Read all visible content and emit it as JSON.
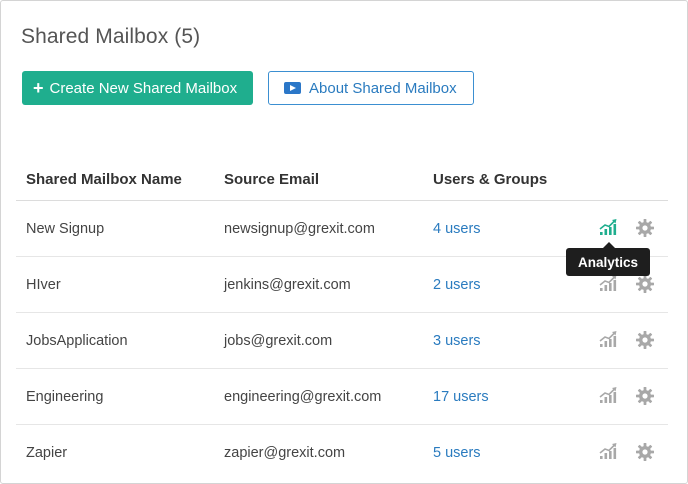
{
  "header": {
    "title": "Shared Mailbox (5)"
  },
  "buttons": {
    "create_label": "Create New Shared Mailbox",
    "create_icon": "plus-icon",
    "about_label": "About Shared Mailbox",
    "about_icon": "video-play-icon"
  },
  "table": {
    "columns": [
      "Shared Mailbox Name",
      "Source Email",
      "Users & Groups"
    ],
    "rows": [
      {
        "name": "New Signup",
        "email": "newsignup@grexit.com",
        "users": "4 users",
        "analytics_active": true
      },
      {
        "name": "HIver",
        "email": "jenkins@grexit.com",
        "users": "2 users",
        "analytics_active": false
      },
      {
        "name": "JobsApplication",
        "email": "jobs@grexit.com",
        "users": "3 users",
        "analytics_active": false
      },
      {
        "name": "Engineering",
        "email": "engineering@grexit.com",
        "users": "17 users",
        "analytics_active": false
      },
      {
        "name": "Zapier",
        "email": "zapier@grexit.com",
        "users": "5 users",
        "analytics_active": false
      }
    ]
  },
  "tooltip": {
    "text": "Analytics"
  },
  "colors": {
    "primary_green": "#1fae8e",
    "link_blue": "#2a7bbf",
    "icon_gray": "#a8a8a8",
    "tooltip_bg": "#1e1e1e"
  }
}
